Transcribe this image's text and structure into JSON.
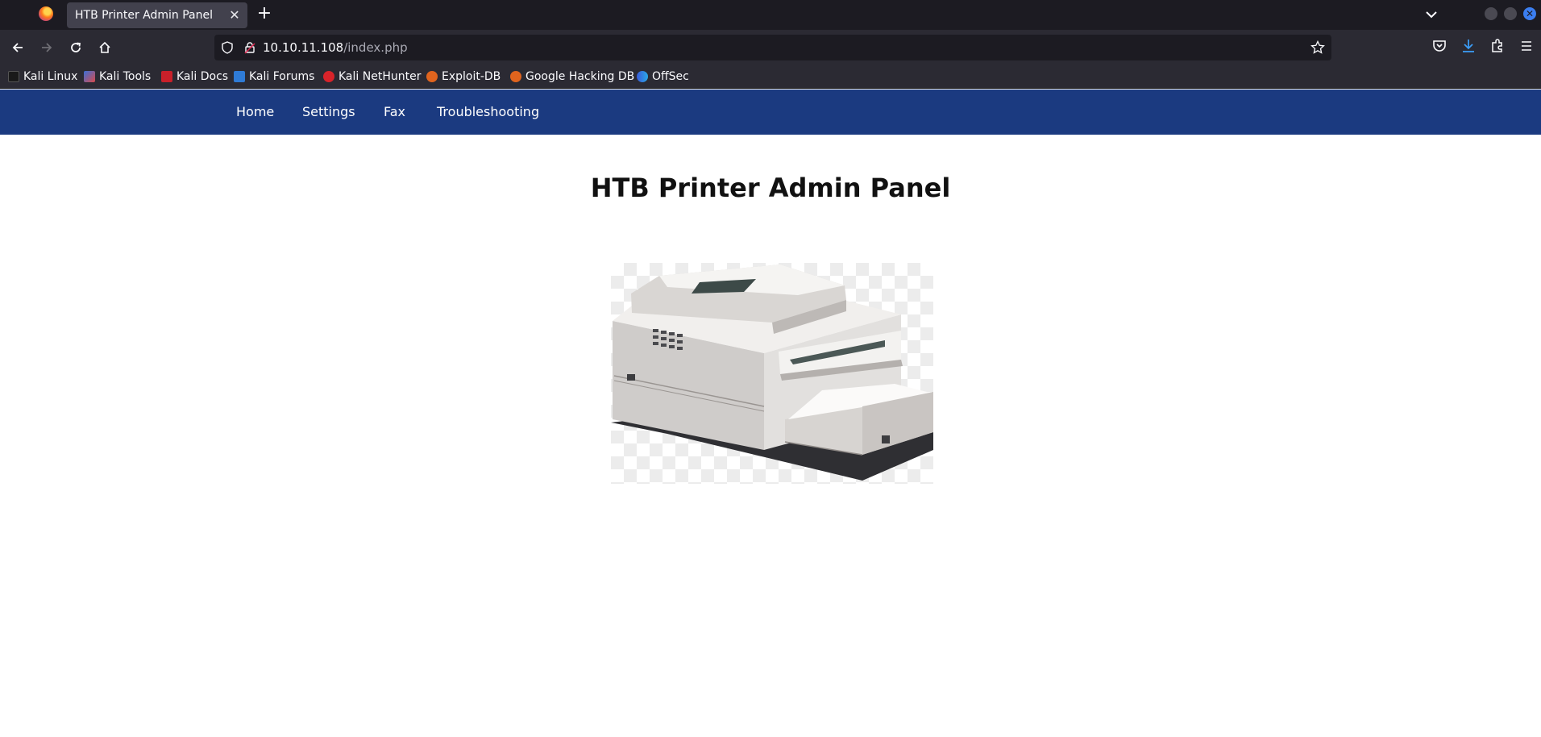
{
  "browser": {
    "tab_title": "HTB Printer Admin Panel",
    "url_host": "10.10.11.108",
    "url_path": "/index.php",
    "bookmarks": [
      {
        "label": "Kali Linux",
        "icon": "kali-dragon-icon"
      },
      {
        "label": "Kali Tools",
        "icon": "kali-tools-icon"
      },
      {
        "label": "Kali Docs",
        "icon": "kali-docs-icon"
      },
      {
        "label": "Kali Forums",
        "icon": "kali-forums-icon"
      },
      {
        "label": "Kali NetHunter",
        "icon": "kali-nethunter-icon"
      },
      {
        "label": "Exploit-DB",
        "icon": "exploit-db-icon"
      },
      {
        "label": "Google Hacking DB",
        "icon": "ghdb-icon"
      },
      {
        "label": "OffSec",
        "icon": "offsec-icon"
      }
    ]
  },
  "site": {
    "nav": [
      "Home",
      "Settings",
      "Fax",
      "Troubleshooting"
    ],
    "title": "HTB Printer Admin Panel",
    "image": "printer-image"
  },
  "colors": {
    "nav_bg": "#1b3a80",
    "chrome_dark": "#1c1b22",
    "chrome": "#2b2a33"
  }
}
